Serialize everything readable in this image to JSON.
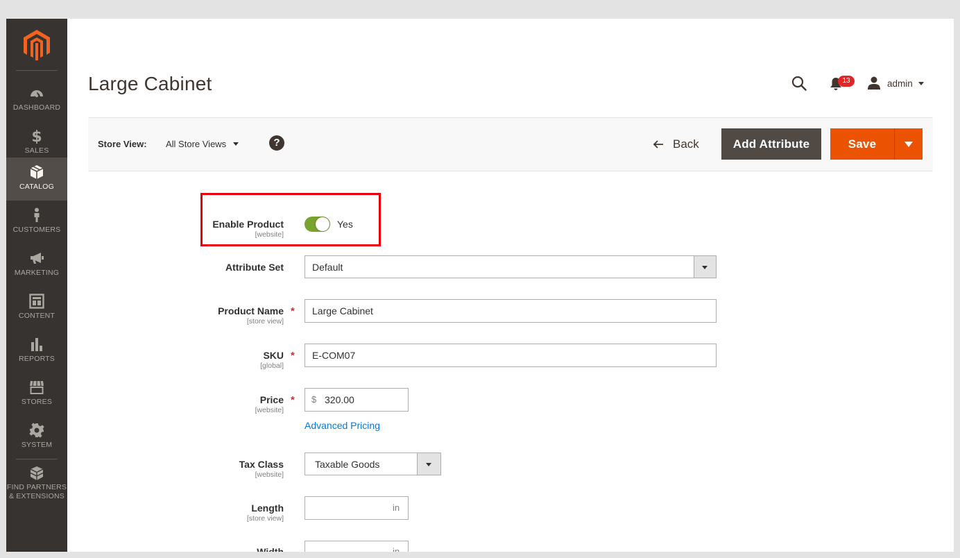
{
  "sidebar": {
    "items": [
      {
        "label": "DASHBOARD",
        "icon": "dashboard-icon"
      },
      {
        "label": "SALES",
        "icon": "dollar-icon"
      },
      {
        "label": "CATALOG",
        "icon": "box-icon",
        "active": true
      },
      {
        "label": "CUSTOMERS",
        "icon": "person-icon"
      },
      {
        "label": "MARKETING",
        "icon": "megaphone-icon"
      },
      {
        "label": "CONTENT",
        "icon": "layout-icon"
      },
      {
        "label": "REPORTS",
        "icon": "bar-chart-icon"
      },
      {
        "label": "STORES",
        "icon": "storefront-icon"
      },
      {
        "label": "SYSTEM",
        "icon": "gear-icon"
      }
    ],
    "partners": {
      "line1": "FIND PARTNERS",
      "line2": "& EXTENSIONS",
      "icon": "blocks-icon"
    }
  },
  "header": {
    "title": "Large Cabinet",
    "notifications_count": "13",
    "user": "admin"
  },
  "toolbar": {
    "store_view_label": "Store View:",
    "store_view_value": "All Store Views",
    "help_label": "?",
    "back_label": "Back",
    "add_attribute_label": "Add Attribute",
    "save_label": "Save"
  },
  "form": {
    "enable_product": {
      "label": "Enable Product",
      "scope": "[website]",
      "value": "Yes"
    },
    "attribute_set": {
      "label": "Attribute Set",
      "value": "Default"
    },
    "product_name": {
      "label": "Product Name",
      "scope": "[store view]",
      "value": "Large Cabinet",
      "required": "*"
    },
    "sku": {
      "label": "SKU",
      "scope": "[global]",
      "value": "E-COM07",
      "required": "*"
    },
    "price": {
      "label": "Price",
      "scope": "[website]",
      "currency": "$",
      "value": "320.00",
      "required": "*"
    },
    "advanced_pricing": "Advanced Pricing",
    "tax_class": {
      "label": "Tax Class",
      "scope": "[website]",
      "value": "Taxable Goods"
    },
    "length": {
      "label": "Length",
      "scope": "[store view]",
      "unit": "in",
      "value": ""
    },
    "width": {
      "label": "Width",
      "unit": "in"
    }
  },
  "colors": {
    "sidebar_bg": "#373330",
    "sidebar_active": "#524d49",
    "save_orange": "#eb5202",
    "add_attribute_bg": "#514943",
    "toggle_on": "#79a22e",
    "link_blue": "#007bdb",
    "highlight_red": "#e8000a"
  }
}
